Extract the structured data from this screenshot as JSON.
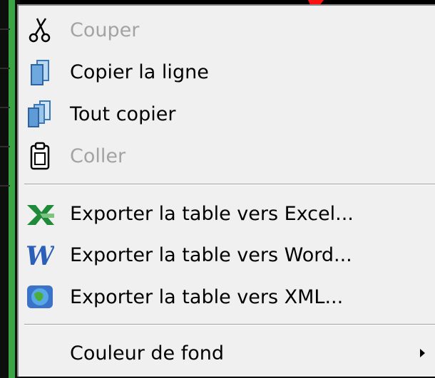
{
  "context_menu": {
    "items": [
      {
        "label": "Couper",
        "icon": "scissors-icon",
        "enabled": false
      },
      {
        "label": "Copier la ligne",
        "icon": "copy-icon",
        "enabled": true
      },
      {
        "label": "Tout copier",
        "icon": "copy-all-icon",
        "enabled": true
      },
      {
        "label": "Coller",
        "icon": "paste-icon",
        "enabled": false
      },
      {
        "label": "Exporter la table vers Excel...",
        "icon": "excel-icon",
        "enabled": true
      },
      {
        "label": "Exporter la table vers Word...",
        "icon": "word-icon",
        "enabled": true
      },
      {
        "label": "Exporter la table vers XML...",
        "icon": "xml-globe-icon",
        "enabled": true
      },
      {
        "label": "Couleur de fond",
        "icon": "",
        "enabled": true,
        "has_submenu": true
      }
    ]
  },
  "colors": {
    "menu_background": "#f0f0f0",
    "disabled_text": "#a3a3a3",
    "accent_red": "#ff1010",
    "background_green": "#39a545"
  }
}
